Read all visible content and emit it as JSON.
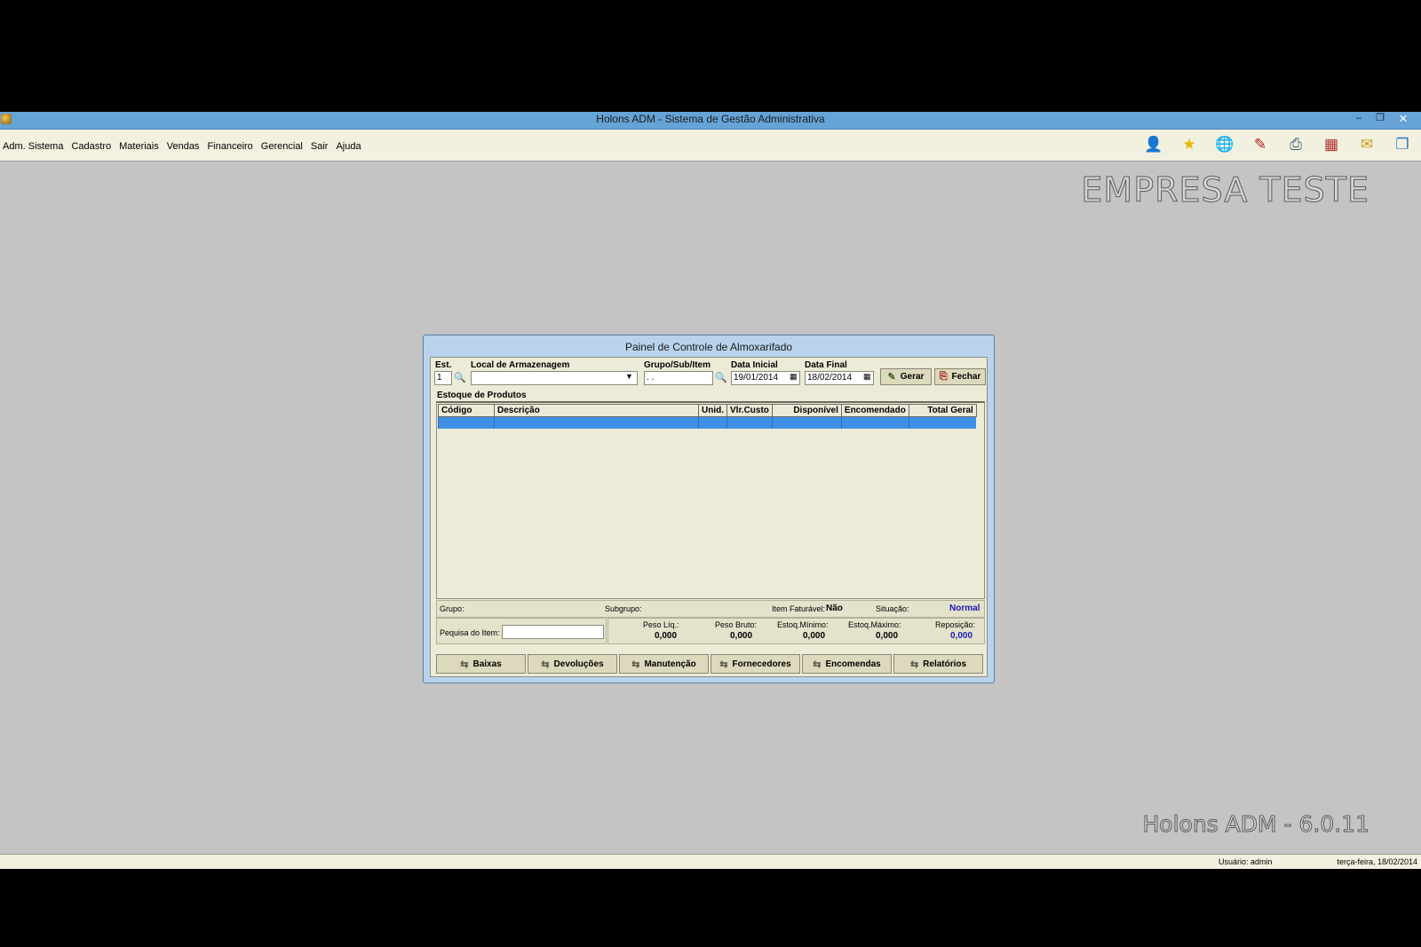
{
  "window": {
    "title": "Holons ADM - Sistema de Gestão Administrativa",
    "min": "–",
    "restore": "❐",
    "close": "✕"
  },
  "menu": [
    "Adm. Sistema",
    "Cadastro",
    "Materiais",
    "Vendas",
    "Financeiro",
    "Gerencial",
    "Sair",
    "Ajuda"
  ],
  "toolbar_icons": [
    "user-icon",
    "star-icon",
    "globe-icon",
    "checklist-icon",
    "printer-icon",
    "calendar-icon",
    "xml-note-icon",
    "window-icon"
  ],
  "company": "EMPRESA TESTE",
  "version": "Holons ADM - 6.0.11",
  "status": {
    "user": "Usuário: admin",
    "date": "terça-feira, 18/02/2014"
  },
  "dialog": {
    "title": "Painel de Controle de Almoxarifado",
    "est_label": "Est.",
    "est_value": "1",
    "local_label": "Local de Armazenagem",
    "local_value": "",
    "grupo_label": "Grupo/Sub/Item",
    "grupo_value": " .  .",
    "data_inicial_label": "Data Inicial",
    "data_inicial_value": "19/01/2014",
    "data_final_label": "Data Final",
    "data_final_value": "18/02/2014",
    "gerar": "Gerar",
    "fechar": "Fechar",
    "section_title": "Estoque de Produtos",
    "columns": [
      "Código",
      "Descrição",
      "Unid.",
      "Vlr.Custo",
      "Disponível",
      "Encomendado",
      "Total Geral"
    ],
    "info": {
      "grupo_label": "Grupo:",
      "subgrupo_label": "Subgrupo:",
      "item_faturavel_label": "Item Faturável:",
      "item_faturavel_value": "Não",
      "situacao_label": "Situação:",
      "situacao_value": "Normal"
    },
    "pesquisa_label": "Pequisa do Item:",
    "pesquisa_value": "",
    "totals": [
      {
        "label": "Peso Líq.:",
        "value": "0,000"
      },
      {
        "label": "Peso Bruto:",
        "value": "0,000"
      },
      {
        "label": "Estoq.Mínimo:",
        "value": "0,000"
      },
      {
        "label": "Estoq.Máximo:",
        "value": "0,000"
      },
      {
        "label": "Reposição:",
        "value": "0,000"
      }
    ],
    "actions": [
      "Baixas",
      "Devoluções",
      "Manutenção",
      "Fornecedores",
      "Encomendas",
      "Relatórios"
    ]
  }
}
